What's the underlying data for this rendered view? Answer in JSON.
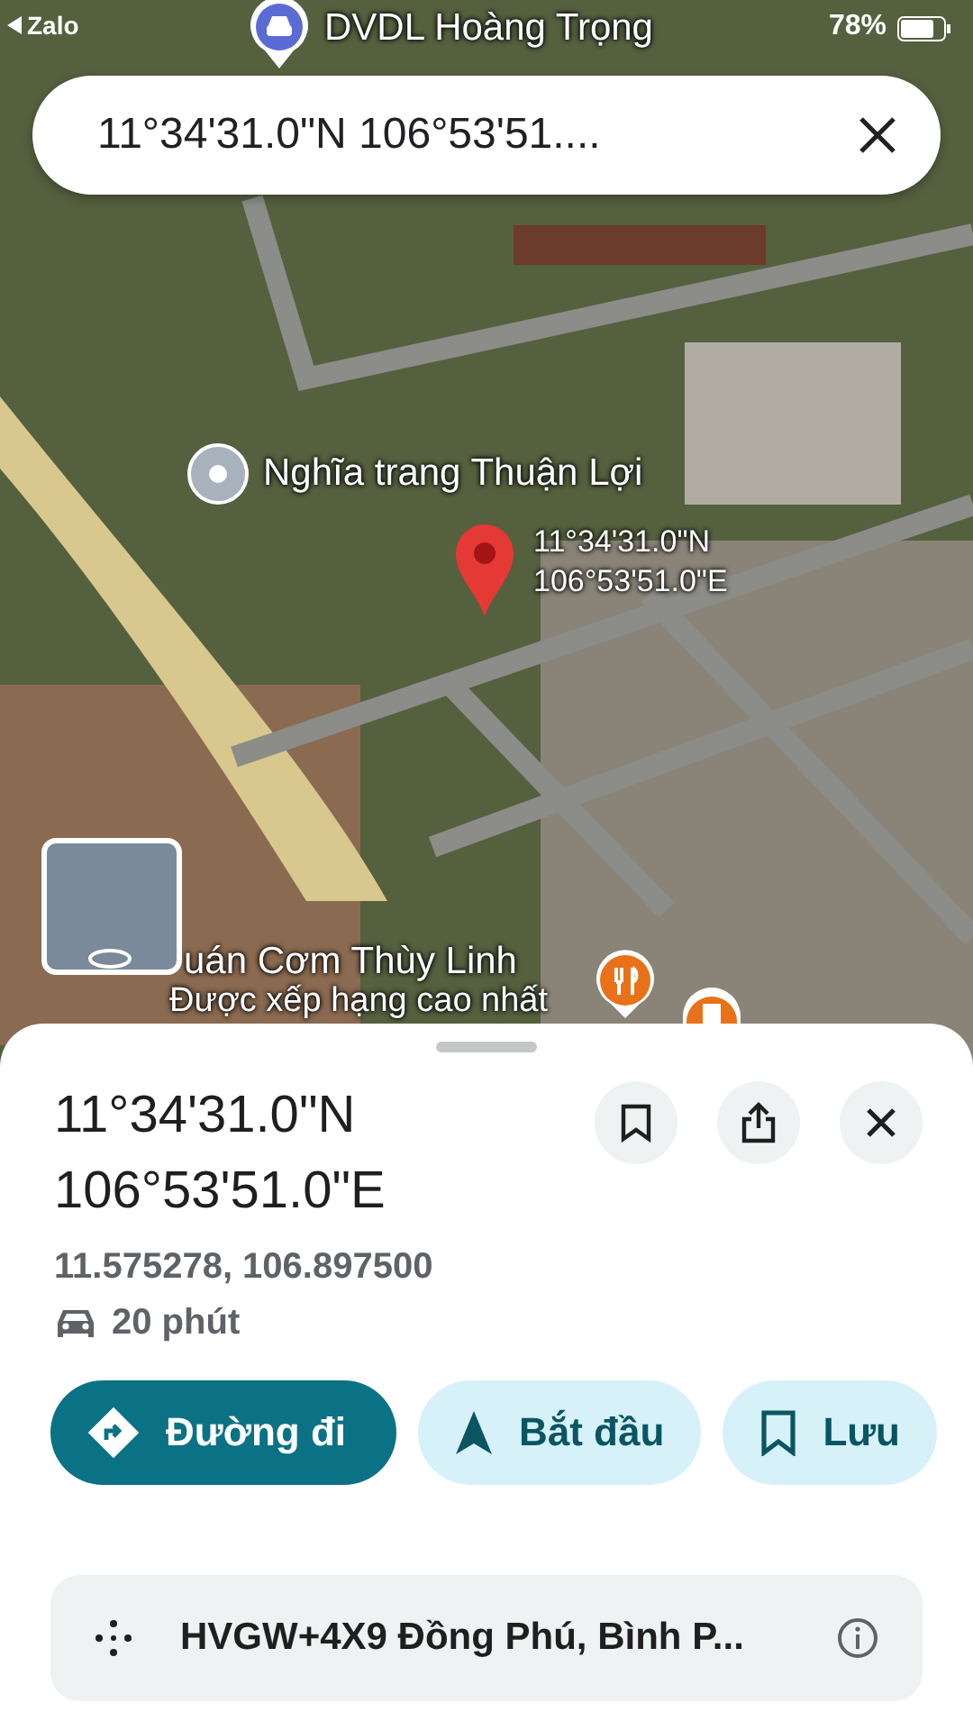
{
  "status_bar": {
    "back_app": "Zalo",
    "battery": "78%"
  },
  "search_bar": {
    "value": "11°34'31.0\"N 106°53'51...."
  },
  "map": {
    "labels": [
      {
        "kind": "car",
        "text": "DVDL Hoàng Trọng"
      },
      {
        "kind": "place",
        "text": "Nghĩa trang Thuận Lợi"
      },
      {
        "kind": "pin",
        "lines": [
          "11°34'31.0\"N",
          "106°53'51.0\"E"
        ]
      },
      {
        "kind": "restaurant",
        "text": "uán Cơm Thùy Linh",
        "subtext": "Được xếp hạng cao nhất"
      }
    ]
  },
  "sheet": {
    "title_lines": [
      "11°34'31.0\"N",
      "106°53'51.0\"E"
    ],
    "coordinates": "11.575278, 106.897500",
    "travel_time": "20 phút",
    "actions": [
      {
        "kind": "primary",
        "label": "Đường đi"
      },
      {
        "kind": "start",
        "label": "Bắt đầu"
      },
      {
        "kind": "save",
        "label": "Lưu"
      }
    ],
    "plus_code": "HVGW+4X9 Đồng Phú, Bình P..."
  }
}
